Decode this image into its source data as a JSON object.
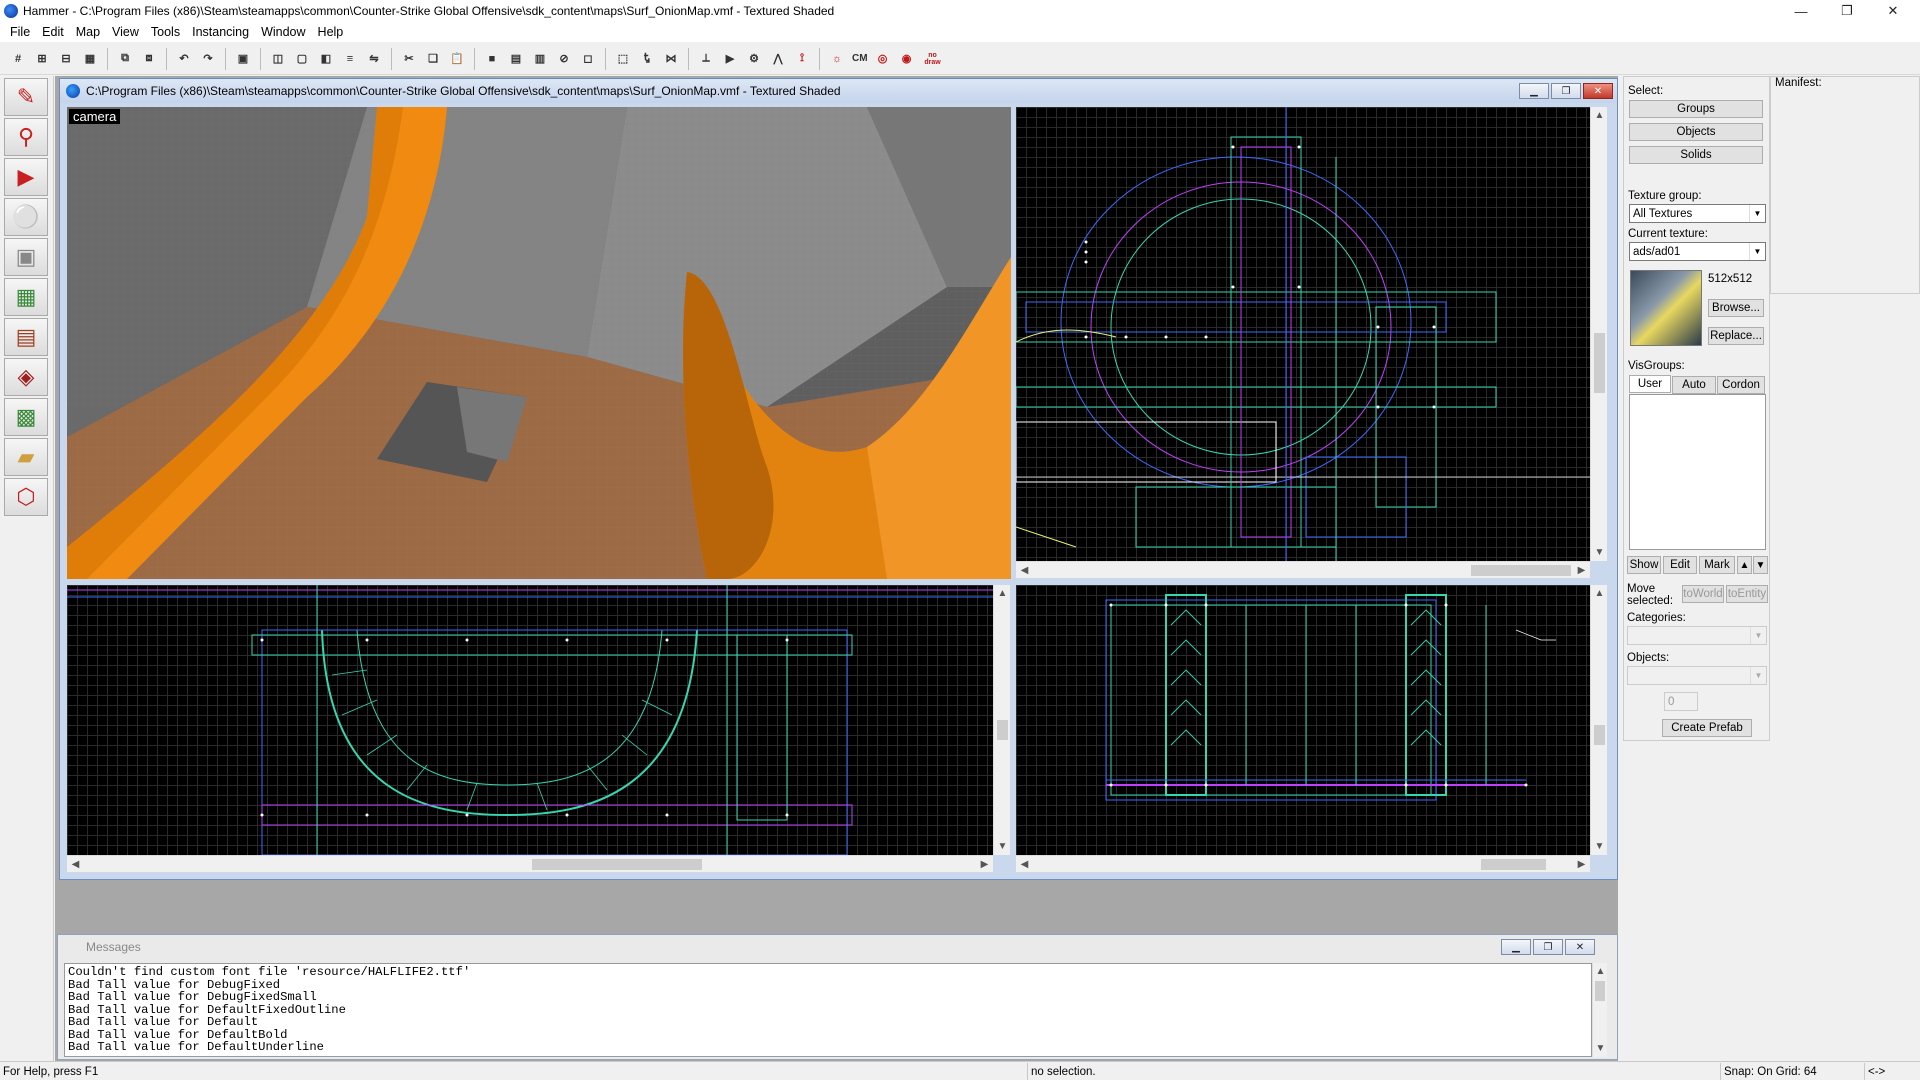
{
  "app": {
    "title": "Hammer - C:\\Program Files (x86)\\Steam\\steamapps\\common\\Counter-Strike Global Offensive\\sdk_content\\maps\\Surf_OnionMap.vmf - Textured Shaded",
    "window_controls": {
      "minimize": "—",
      "maximize": "❐",
      "close": "✕"
    }
  },
  "menu": [
    "File",
    "Edit",
    "Map",
    "View",
    "Tools",
    "Instancing",
    "Window",
    "Help"
  ],
  "toolbar": {
    "icons": [
      "grid-toggle-icon",
      "grid-smaller-icon",
      "grid-larger-icon",
      "grid-options-icon",
      "group-icon",
      "ungroup-icon",
      "undo-icon",
      "redo-icon",
      "hide-icon",
      "carve-icon",
      "hollow-icon",
      "texture-lock-icon",
      "align-icon",
      "flip-icon",
      "cut-icon",
      "copy-icon",
      "paste-icon",
      "texture-apply-icon",
      "decal-icon",
      "overlay-icon",
      "entity-report-icon",
      "check-problems-icon",
      "selection-mode-icon",
      "texture-browser-icon",
      "toggle-3d-grid-icon",
      "texel-icon",
      "run-map-icon",
      "compile-icon",
      "model-icon",
      "visgroup-icon",
      "lighting-icon",
      "cubemap-icon",
      "nodraw-icon"
    ],
    "text_buttons": {
      "cm": "CM",
      "nodraw": "no draw"
    }
  },
  "left_tools": [
    "selection-tool-icon",
    "magnify-tool-icon",
    "camera-tool-icon",
    "entity-tool-icon",
    "block-tool-icon",
    "texture-tool-icon",
    "apply-texture-tool-icon",
    "decal-tool-icon",
    "overlay-tool-icon",
    "clip-tool-icon",
    "vertex-tool-icon"
  ],
  "map_window": {
    "title": "C:\\Program Files (x86)\\Steam\\steamapps\\common\\Counter-Strike Global Offensive\\sdk_content\\maps\\Surf_OnionMap.vmf - Textured Shaded",
    "camera_label": "camera"
  },
  "right_panel": {
    "select_label": "Select:",
    "select_buttons": [
      "Groups",
      "Objects",
      "Solids"
    ],
    "texture_group_label": "Texture group:",
    "texture_group_value": "All Textures",
    "current_texture_label": "Current texture:",
    "current_texture_value": "ads/ad01",
    "texture_size": "512x512",
    "browse_button": "Browse...",
    "replace_button": "Replace...",
    "visgroups_label": "VisGroups:",
    "visgroup_tabs": [
      "User",
      "Auto",
      "Cordon"
    ],
    "visgroup_buttons": [
      "Show",
      "Edit",
      "Mark"
    ],
    "move_selected_label": "Move selected:",
    "to_world_button": "toWorld",
    "to_entity_button": "toEntity",
    "categories_label": "Categories:",
    "objects_label": "Objects:",
    "objects_count": "0",
    "create_prefab_button": "Create Prefab"
  },
  "manifest_label": "Manifest:",
  "messages": {
    "title": "Messages",
    "lines": [
      "Couldn't find custom font file 'resource/HALFLIFE2.ttf'",
      "Bad Tall value for DebugFixed",
      "Bad Tall value for DebugFixedSmall",
      "Bad Tall value for DefaultFixedOutline",
      "Bad Tall value for Default",
      "Bad Tall value for DefaultBold",
      "Bad Tall value for DefaultUnderline"
    ]
  },
  "status": {
    "help": "For Help, press F1",
    "selection": "no selection.",
    "snap": "Snap: On Grid: 64",
    "arrows": "<->"
  },
  "colors": {
    "orange_ramp": "#f08a10",
    "floor_brown": "#9c6a45",
    "wall_grey": "#6e6e6e",
    "wire_cyan": "#38d6b0",
    "wire_magenta": "#c040ff",
    "wire_blue": "#3c6cff"
  }
}
